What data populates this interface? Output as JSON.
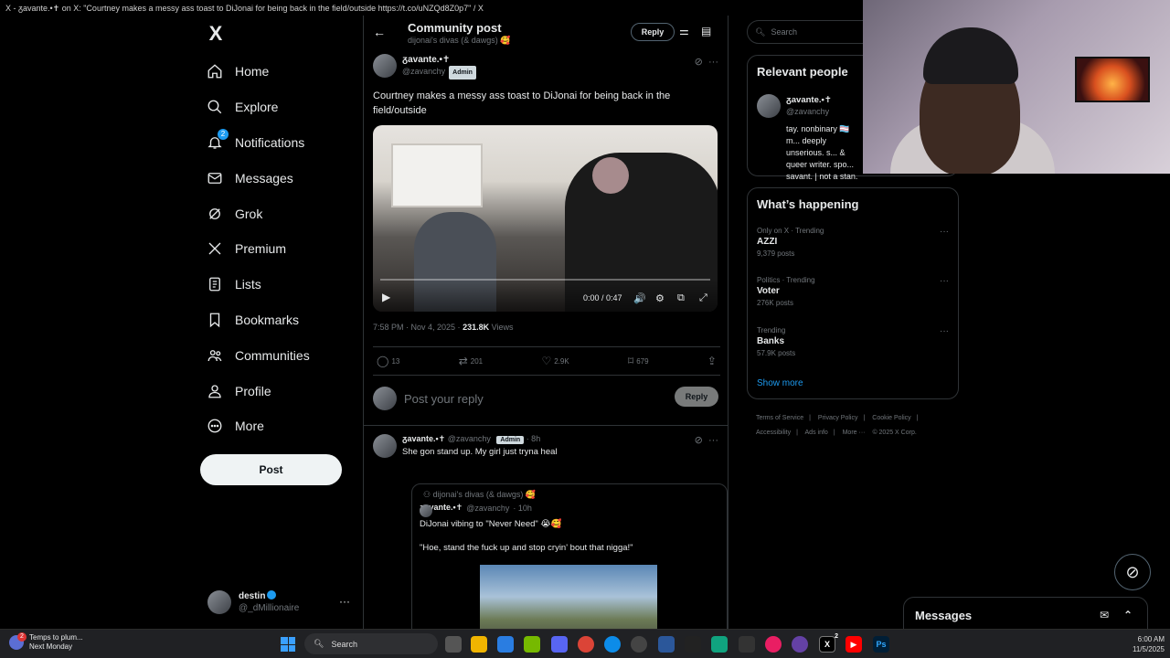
{
  "window": {
    "title": "X - ᵹavante.•✝ on X: \"Courtney makes a messy ass toast to DiJonai for being back in the field/outside https://t.co/uNZQd8Z0p7\" / X"
  },
  "nav": {
    "logo": "X",
    "items": [
      {
        "label": "Home",
        "icon": "home-icon"
      },
      {
        "label": "Explore",
        "icon": "search-icon"
      },
      {
        "label": "Notifications",
        "icon": "bell-icon",
        "badge": "2"
      },
      {
        "label": "Messages",
        "icon": "mail-icon"
      },
      {
        "label": "Grok",
        "icon": "grok-icon"
      },
      {
        "label": "Premium",
        "icon": "x-premium-icon"
      },
      {
        "label": "Lists",
        "icon": "list-icon"
      },
      {
        "label": "Bookmarks",
        "icon": "bookmark-icon"
      },
      {
        "label": "Communities",
        "icon": "communities-icon"
      },
      {
        "label": "Profile",
        "icon": "person-icon"
      },
      {
        "label": "More",
        "icon": "more-circle-icon"
      }
    ],
    "post_label": "Post",
    "account": {
      "name": "destin",
      "handle": "@_dMillionaire"
    }
  },
  "header": {
    "title": "Community post",
    "community": "dijonai's divas (& dawgs) 🥰",
    "reply_label": "Reply"
  },
  "post": {
    "author": "ᵹavante.•✝",
    "handle": "@zavanchy",
    "role": "Admin",
    "text": "Courtney makes a messy ass toast to DiJonai for being back in the field/outside",
    "video_time": "0:00 / 0:47",
    "timestamp": "7:58 PM · Nov 4, 2025 ·",
    "views": "231.8K",
    "views_label": "Views",
    "stats": {
      "replies": "13",
      "reposts": "201",
      "likes": "2.9K",
      "bookmarks": "679"
    }
  },
  "reply_box": {
    "placeholder": "Post your reply",
    "button": "Reply"
  },
  "reply": {
    "author": "ᵹavante.•✝",
    "handle": "@zavanchy",
    "role": "Admin",
    "time": "· 8h",
    "text": "She gon stand up. My girl just tryna heal",
    "quote": {
      "community": "dijonai's divas (& dawgs) 🥰",
      "author": "ᵹavante.•✝",
      "handle": "@zavanchy",
      "time": "· 10h",
      "line1": "DiJonai vibing to \"Never Need\" 😭🥰",
      "line2": "\"Hoe, stand the fuck up and stop cryin' bout that nigga!\""
    }
  },
  "sidebar": {
    "search_placeholder": "Search",
    "relevant_title": "Relevant people",
    "relevant_name": "ᵹavante.•✝",
    "relevant_handle": "@zavanchy",
    "relevant_bio": "tay. nonbinary 🏳️‍⚧️ m... deeply unserious. s... & queer writer. spo... savant. | not a stan.",
    "whats_title": "What’s happening",
    "trends": [
      {
        "context": "Only on X · Trending",
        "name": "AZZI",
        "count": "9,379 posts"
      },
      {
        "context": "Politics · Trending",
        "name": "Voter",
        "count": "276K posts"
      },
      {
        "context": "Trending",
        "name": "Banks",
        "count": "57.9K posts"
      }
    ],
    "show_more": "Show more",
    "footer": [
      "Terms of Service",
      "|",
      "Privacy Policy",
      "|",
      "Cookie Policy",
      "|",
      "Accessibility",
      "|",
      "Ads info",
      "|",
      "More ···",
      "© 2025 X Corp."
    ]
  },
  "messages_drawer": {
    "title": "Messages"
  },
  "taskbar": {
    "weather_title": "Temps to plum...",
    "weather_sub": "Next Monday",
    "weather_badge": "2",
    "search": "Search",
    "time": "6:00 AM",
    "date": "11/5/2025",
    "x_badge": "2"
  }
}
